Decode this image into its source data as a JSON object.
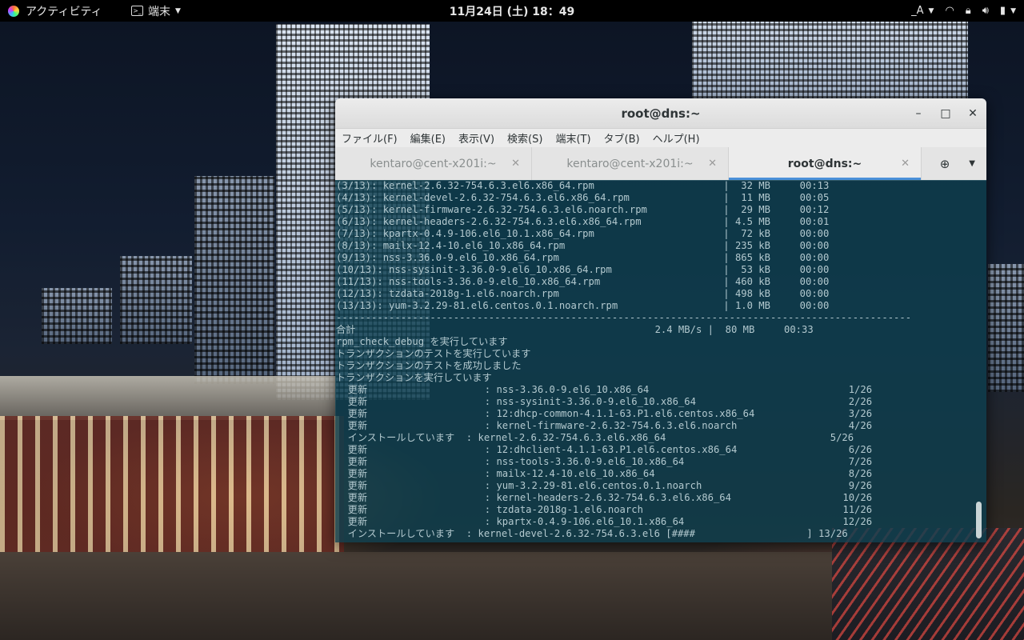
{
  "topbar": {
    "activities": "アクティビティ",
    "app_menu": "端末",
    "clock": "11月24日 (土) 18：49",
    "input_method": "_A"
  },
  "window": {
    "title": "root@dns:~",
    "menu": [
      "ファイル(F)",
      "編集(E)",
      "表示(V)",
      "検索(S)",
      "端末(T)",
      "タブ(B)",
      "ヘルプ(H)"
    ],
    "tabs": [
      {
        "label": "kentaro@cent-x201i:~",
        "active": false
      },
      {
        "label": "kentaro@cent-x201i:~",
        "active": false
      },
      {
        "label": "root@dns:~",
        "active": true
      }
    ]
  },
  "terminal": {
    "lines": [
      "(3/13): kernel-2.6.32-754.6.3.el6.x86_64.rpm                      |  32 MB     00:13",
      "(4/13): kernel-devel-2.6.32-754.6.3.el6.x86_64.rpm                |  11 MB     00:05",
      "(5/13): kernel-firmware-2.6.32-754.6.3.el6.noarch.rpm             |  29 MB     00:12",
      "(6/13): kernel-headers-2.6.32-754.6.3.el6.x86_64.rpm              | 4.5 MB     00:01",
      "(7/13): kpartx-0.4.9-106.el6_10.1.x86_64.rpm                      |  72 kB     00:00",
      "(8/13): mailx-12.4-10.el6_10.x86_64.rpm                           | 235 kB     00:00",
      "(9/13): nss-3.36.0-9.el6_10.x86_64.rpm                            | 865 kB     00:00",
      "(10/13): nss-sysinit-3.36.0-9.el6_10.x86_64.rpm                   |  53 kB     00:00",
      "(11/13): nss-tools-3.36.0-9.el6_10.x86_64.rpm                     | 460 kB     00:00",
      "(12/13): tzdata-2018g-1.el6.noarch.rpm                            | 498 kB     00:00",
      "(13/13): yum-3.2.29-81.el6.centos.0.1.noarch.rpm                  | 1.0 MB     00:00",
      "--------------------------------------------------------------------------------------------------",
      "合計                                                   2.4 MB/s |  80 MB     00:33",
      "rpm_check_debug を実行しています",
      "トランザクションのテストを実行しています",
      "トランザクションのテストを成功しました",
      "トランザクションを実行しています",
      "  更新                    : nss-3.36.0-9.el6_10.x86_64                                  1/26",
      "  更新                    : nss-sysinit-3.36.0-9.el6_10.x86_64                          2/26",
      "  更新                    : 12:dhcp-common-4.1.1-63.P1.el6.centos.x86_64                3/26",
      "  更新                    : kernel-firmware-2.6.32-754.6.3.el6.noarch                   4/26",
      "  インストールしています  : kernel-2.6.32-754.6.3.el6.x86_64                            5/26",
      "  更新                    : 12:dhclient-4.1.1-63.P1.el6.centos.x86_64                   6/26",
      "  更新                    : nss-tools-3.36.0-9.el6_10.x86_64                            7/26",
      "  更新                    : mailx-12.4-10.el6_10.x86_64                                 8/26",
      "  更新                    : yum-3.2.29-81.el6.centos.0.1.noarch                         9/26",
      "  更新                    : kernel-headers-2.6.32-754.6.3.el6.x86_64                   10/26",
      "  更新                    : tzdata-2018g-1.el6.noarch                                  11/26",
      "  更新                    : kpartx-0.4.9-106.el6_10.1.x86_64                           12/26",
      "  インストールしています  : kernel-devel-2.6.32-754.6.3.el6 [####                   ] 13/26"
    ]
  },
  "icons": {
    "gnome": "gnome-logo-icon",
    "terminal": "terminal-icon",
    "wifi": "wifi-icon",
    "lock": "lock-icon",
    "volume": "volume-icon",
    "battery": "battery-icon"
  }
}
